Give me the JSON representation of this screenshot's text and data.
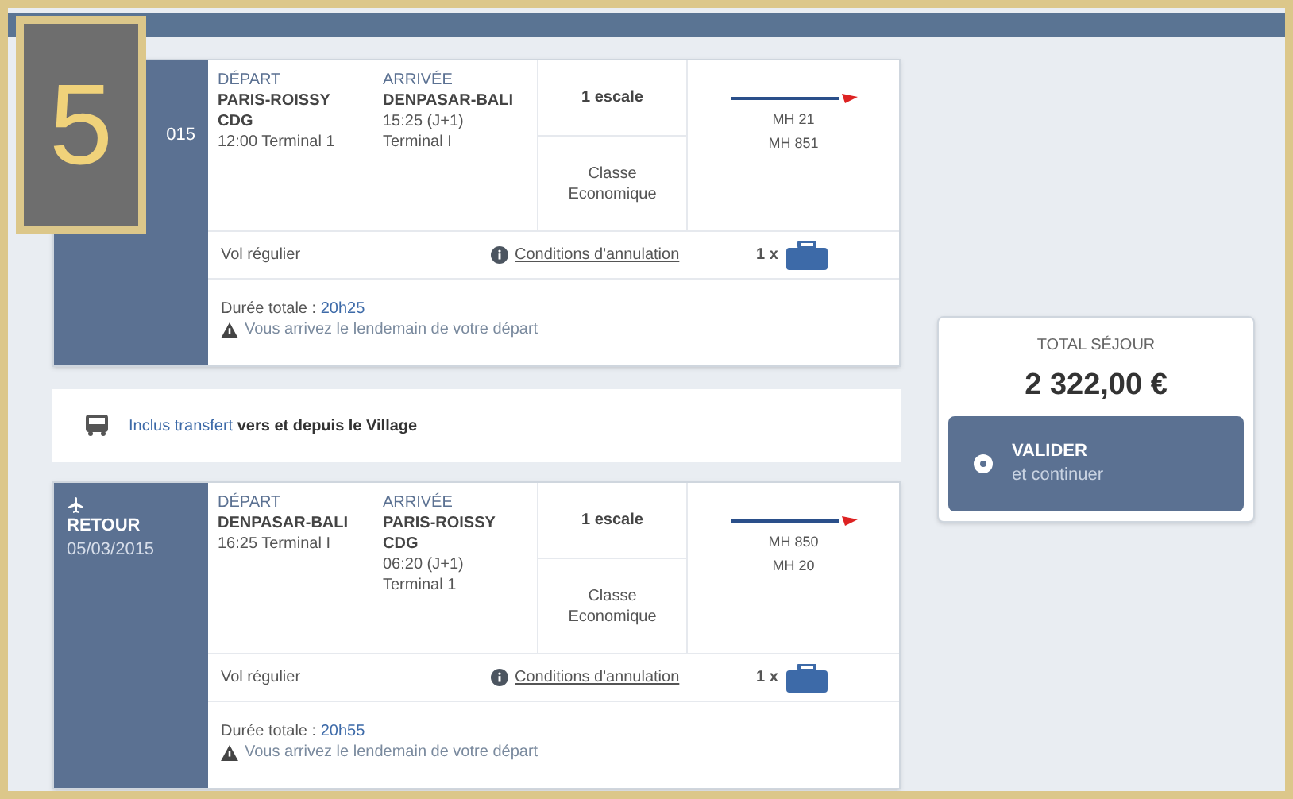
{
  "step_badge": "5",
  "flights": [
    {
      "date": "015",
      "depart_label": "DÉPART",
      "depart_city": "PARIS-ROISSY CDG",
      "depart_time": "12:00 Terminal 1",
      "arrival_label": "ARRIVÉE",
      "arrival_city": "DENPASAR-BALI",
      "arrival_time": "15:25 (J+1) Terminal I",
      "stops": "1 escale",
      "cabin": "Classe Economique",
      "flight_codes": [
        "MH 21",
        "MH 851"
      ],
      "flight_type": "Vol régulier",
      "cancel_link": "Conditions d'annulation",
      "baggage": "1 x",
      "duration_label": "Durée totale :",
      "duration": "20h25",
      "warning": "Vous arrivez le lendemain de votre départ"
    },
    {
      "side_label": "RETOUR",
      "date": "05/03/2015",
      "depart_label": "DÉPART",
      "depart_city": "DENPASAR-BALI",
      "depart_time": "16:25 Terminal I",
      "arrival_label": "ARRIVÉE",
      "arrival_city": "PARIS-ROISSY CDG",
      "arrival_time": "06:20 (J+1) Terminal 1",
      "stops": "1 escale",
      "cabin": "Classe Economique",
      "flight_codes": [
        "MH 850",
        "MH 20"
      ],
      "flight_type": "Vol régulier",
      "cancel_link": "Conditions d'annulation",
      "baggage": "1 x",
      "duration_label": "Durée totale :",
      "duration": "20h55",
      "warning": "Vous arrivez le lendemain de votre départ"
    }
  ],
  "transfer": {
    "highlight": "Inclus transfert",
    "text": "vers et depuis le Village"
  },
  "total": {
    "label": "TOTAL SÉJOUR",
    "amount": "2 322,00 €",
    "button_title": "VALIDER",
    "button_subtitle": "et continuer"
  }
}
